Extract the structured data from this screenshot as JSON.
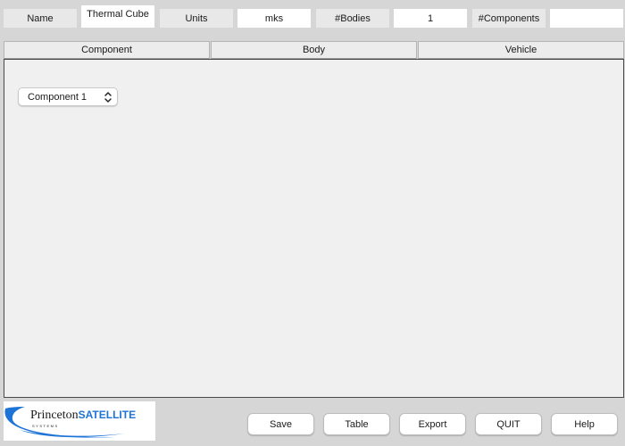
{
  "header": {
    "name_label": "Name",
    "name_value": "Thermal Cube",
    "units_label": "Units",
    "units_value": "mks",
    "bodies_label": "#Bodies",
    "bodies_value": "1",
    "components_label": "#Components",
    "components_value": ""
  },
  "tabs": [
    {
      "label": "Component"
    },
    {
      "label": "Body"
    },
    {
      "label": "Vehicle"
    }
  ],
  "component_select": {
    "selected": "Component 1"
  },
  "logo": {
    "word1": "Princeton",
    "word2": "SATELLITE",
    "word3": "SYSTEMS",
    "swoosh_color": "#1e74d6"
  },
  "buttons": {
    "save": "Save",
    "table": "Table",
    "export": "Export",
    "quit": "QUIT",
    "help": "Help"
  }
}
